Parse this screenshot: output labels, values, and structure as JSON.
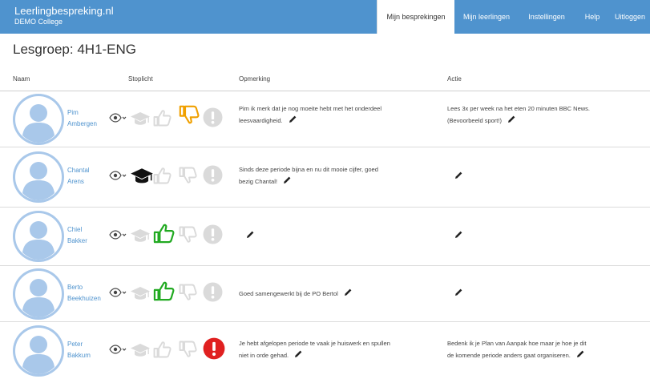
{
  "app": {
    "brand_title": "Leerlingbespreking.nl",
    "brand_subtitle": "DEMO College"
  },
  "nav": {
    "items": [
      {
        "label": "Mijn besprekingen",
        "active": true
      },
      {
        "label": "Mijn leerlingen",
        "active": false
      },
      {
        "label": "Instellingen",
        "active": false
      },
      {
        "label": "Help",
        "active": false
      },
      {
        "label": "Uitloggen",
        "active": false
      }
    ]
  },
  "page": {
    "title": "Lesgroep: 4H1-ENG"
  },
  "table": {
    "headers": {
      "name": "Naam",
      "status": "Stoplicht",
      "remark": "Opmerking",
      "action": "Actie"
    },
    "rows": [
      {
        "name_line1": "Pim",
        "name_line2": "Ambergen",
        "active_status": "thumbs-down",
        "remark_line1": "Pim ik merk dat je nog moeite hebt met het onderdeel",
        "remark_line2": "leesvaardigheid.",
        "action_line1": "Lees 3x per week na het eten 20 minuten BBC News.",
        "action_line2": "(Bevoorbeeld sport!)"
      },
      {
        "name_line1": "Chantal",
        "name_line2": "Arens",
        "active_status": "graduation-cap",
        "remark_line1": "Sinds deze periode bijna en nu dit mooie cijfer, goed",
        "remark_line2": "bezig Chantal!",
        "action_line1": "",
        "action_line2": ""
      },
      {
        "name_line1": "Chiel",
        "name_line2": "Bakker",
        "active_status": "thumbs-up",
        "remark_line1": "",
        "remark_line2": "",
        "action_line1": "",
        "action_line2": ""
      },
      {
        "name_line1": "Berto",
        "name_line2": "Beekhuizen",
        "active_status": "thumbs-up",
        "remark_line1": "Goed samengewerkt bij de PO Bertol",
        "remark_line2": "",
        "action_line1": "",
        "action_line2": ""
      },
      {
        "name_line1": "Peter",
        "name_line2": "Bakkum",
        "active_status": "alert",
        "remark_line1": "Je hebt afgelopen periode te vaak je huiswerk en spullen",
        "remark_line2": "niet in orde gehad.",
        "action_line1": "Bedenk ik je Plan van Aanpak hoe maar je hoe je dit",
        "action_line2": "de komende periode anders gaat organiseren."
      }
    ]
  },
  "colors": {
    "brand_blue": "#4f93ce",
    "status_inactive": "#dadada",
    "thumbs_up_active": "#22aa22",
    "thumbs_down_active": "#f0a000",
    "graduation_active": "#111111",
    "alert_active": "#e02020",
    "avatar_fill": "#a9c8ea"
  },
  "icons": {
    "avatar": "user-avatar-icon",
    "eye": "eye-dropdown-icon",
    "status": [
      "graduation-cap-icon",
      "thumbs-up-icon",
      "thumbs-down-icon",
      "alert-icon"
    ],
    "edit": "pencil-icon"
  }
}
